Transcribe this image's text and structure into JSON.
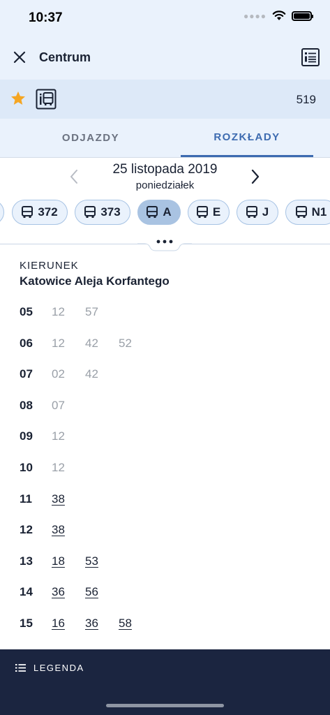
{
  "status_bar": {
    "time": "10:37"
  },
  "header": {
    "title": "Centrum"
  },
  "stop": {
    "number": "519"
  },
  "tabs": [
    {
      "label": "ODJAZDY",
      "active": false
    },
    {
      "label": "ROZKŁADY",
      "active": true
    }
  ],
  "date": {
    "main": "25 listopada 2019",
    "weekday": "poniedziałek"
  },
  "lines": [
    {
      "label": "",
      "active": false
    },
    {
      "label": "372",
      "active": false
    },
    {
      "label": "373",
      "active": false
    },
    {
      "label": "A",
      "active": true
    },
    {
      "label": "E",
      "active": false
    },
    {
      "label": "J",
      "active": false
    },
    {
      "label": "N1",
      "active": false
    }
  ],
  "direction": {
    "label": "KIERUNEK",
    "name": "Katowice Aleja Korfantego"
  },
  "timetable": [
    {
      "hour": "05",
      "minutes": [
        {
          "m": "12",
          "past": true
        },
        {
          "m": "57",
          "past": true
        }
      ]
    },
    {
      "hour": "06",
      "minutes": [
        {
          "m": "12",
          "past": true
        },
        {
          "m": "42",
          "past": true
        },
        {
          "m": "52",
          "past": true
        }
      ]
    },
    {
      "hour": "07",
      "minutes": [
        {
          "m": "02",
          "past": true
        },
        {
          "m": "42",
          "past": true
        }
      ]
    },
    {
      "hour": "08",
      "minutes": [
        {
          "m": "07",
          "past": true
        }
      ]
    },
    {
      "hour": "09",
      "minutes": [
        {
          "m": "12",
          "past": true
        }
      ]
    },
    {
      "hour": "10",
      "minutes": [
        {
          "m": "12",
          "past": true
        }
      ]
    },
    {
      "hour": "11",
      "minutes": [
        {
          "m": "38",
          "past": false
        }
      ]
    },
    {
      "hour": "12",
      "minutes": [
        {
          "m": "38",
          "past": false
        }
      ]
    },
    {
      "hour": "13",
      "minutes": [
        {
          "m": "18",
          "past": false
        },
        {
          "m": "53",
          "past": false
        }
      ]
    },
    {
      "hour": "14",
      "minutes": [
        {
          "m": "36",
          "past": false
        },
        {
          "m": "56",
          "past": false
        }
      ]
    },
    {
      "hour": "15",
      "minutes": [
        {
          "m": "16",
          "past": false
        },
        {
          "m": "36",
          "past": false
        },
        {
          "m": "58",
          "past": false
        }
      ]
    }
  ],
  "footer": {
    "legend_label": "LEGENDA"
  },
  "colors": {
    "header_bg": "#eaf2fc",
    "stop_bar_bg": "#dde9f8",
    "accent": "#3d6bb0",
    "active_chip": "#a9c3e2",
    "star": "#f5a623",
    "footer_bg": "#1b2540",
    "past_minute": "#9aa0a8"
  },
  "icons": {
    "close": "close-icon",
    "list": "timetable-list-icon",
    "favorite": "star-icon",
    "stop_type": "bus-stop-icon",
    "prev": "chevron-left-icon",
    "next": "chevron-right-icon",
    "bus": "bus-icon",
    "more": "more-dots-icon",
    "legend": "list-icon"
  }
}
